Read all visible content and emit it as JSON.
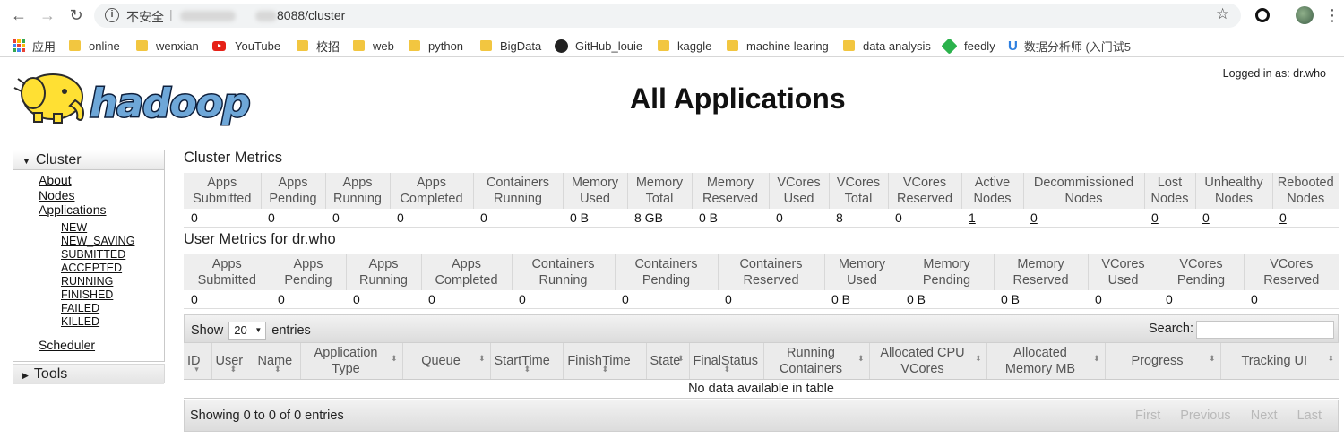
{
  "browser": {
    "insecure_label": "不安全",
    "url_suffix": "8088/cluster",
    "bookmarks": [
      {
        "label": "应用",
        "icon": "apps-grid-icon"
      },
      {
        "label": "online",
        "icon": "folder-icon"
      },
      {
        "label": "wenxian",
        "icon": "folder-icon"
      },
      {
        "label": "YouTube",
        "icon": "youtube-icon"
      },
      {
        "label": "校招",
        "icon": "folder-icon"
      },
      {
        "label": "web",
        "icon": "folder-icon"
      },
      {
        "label": "python",
        "icon": "folder-icon"
      },
      {
        "label": "BigData",
        "icon": "folder-icon"
      },
      {
        "label": "GitHub_louie",
        "icon": "github-icon"
      },
      {
        "label": "kaggle",
        "icon": "folder-icon"
      },
      {
        "label": "machine learing",
        "icon": "folder-icon"
      },
      {
        "label": "data analysis",
        "icon": "folder-icon"
      },
      {
        "label": "feedly",
        "icon": "feedly-icon"
      },
      {
        "label": "数据分析师 (入门试5",
        "icon": "u-icon"
      }
    ]
  },
  "header": {
    "logged_in": "Logged in as: dr.who",
    "title": "All Applications"
  },
  "sidebar": {
    "cluster": {
      "label": "Cluster",
      "links": [
        "About",
        "Nodes",
        "Applications"
      ],
      "app_states": [
        "NEW",
        "NEW_SAVING",
        "SUBMITTED",
        "ACCEPTED",
        "RUNNING",
        "FINISHED",
        "FAILED",
        "KILLED"
      ],
      "scheduler": "Scheduler"
    },
    "tools": {
      "label": "Tools"
    }
  },
  "cluster_metrics": {
    "title": "Cluster Metrics",
    "headers": [
      "Apps Submitted",
      "Apps Pending",
      "Apps Running",
      "Apps Completed",
      "Containers Running",
      "Memory Used",
      "Memory Total",
      "Memory Reserved",
      "VCores Used",
      "VCores Total",
      "VCores Reserved",
      "Active Nodes",
      "Decommissioned Nodes",
      "Lost Nodes",
      "Unhealthy Nodes",
      "Rebooted Nodes"
    ],
    "values": [
      "0",
      "0",
      "0",
      "0",
      "0",
      "0 B",
      "8 GB",
      "0 B",
      "0",
      "8",
      "0",
      "1",
      "0",
      "0",
      "0",
      "0"
    ]
  },
  "user_metrics": {
    "title": "User Metrics for dr.who",
    "headers": [
      "Apps Submitted",
      "Apps Pending",
      "Apps Running",
      "Apps Completed",
      "Containers Running",
      "Containers Pending",
      "Containers Reserved",
      "Memory Used",
      "Memory Pending",
      "Memory Reserved",
      "VCores Used",
      "VCores Pending",
      "VCores Reserved"
    ],
    "values": [
      "0",
      "0",
      "0",
      "0",
      "0",
      "0",
      "0",
      "0 B",
      "0 B",
      "0 B",
      "0",
      "0",
      "0"
    ]
  },
  "apps_table": {
    "show_label": "Show",
    "entries_label": "entries",
    "page_size": "20",
    "search_label": "Search:",
    "columns": [
      "ID",
      "User",
      "Name",
      "Application Type",
      "Queue",
      "StartTime",
      "FinishTime",
      "State",
      "FinalStatus",
      "Running Containers",
      "Allocated CPU VCores",
      "Allocated Memory MB",
      "Progress",
      "Tracking UI"
    ],
    "empty_message": "No data available in table",
    "info": "Showing 0 to 0 of 0 entries",
    "pager": [
      "First",
      "Previous",
      "Next",
      "Last"
    ]
  }
}
